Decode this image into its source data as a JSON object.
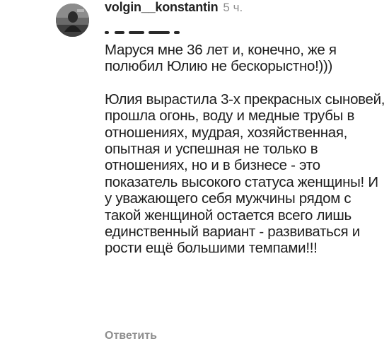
{
  "comment": {
    "username": "volgin__konstantin",
    "timestamp": "5 ч.",
    "paragraphs": [
      "Маруся мне 36 лет и, конечно, же я полюбил Юлию не бескорыстно!)))",
      "Юлия вырастила 3-х прекрасных сыновей, прошла огонь, воду и медные трубы в отношениях, мудрая, хозяйственная, опытная и успешная не только в отношениях, но и в бизнесе - это показатель высокого статуса женщины! И у уважающего себя мужчины рядом с такой женщиной остается всего лишь единственный вариант - развиваться и рости ещё большими темпами!!!"
    ],
    "reply_label": "Ответить"
  }
}
